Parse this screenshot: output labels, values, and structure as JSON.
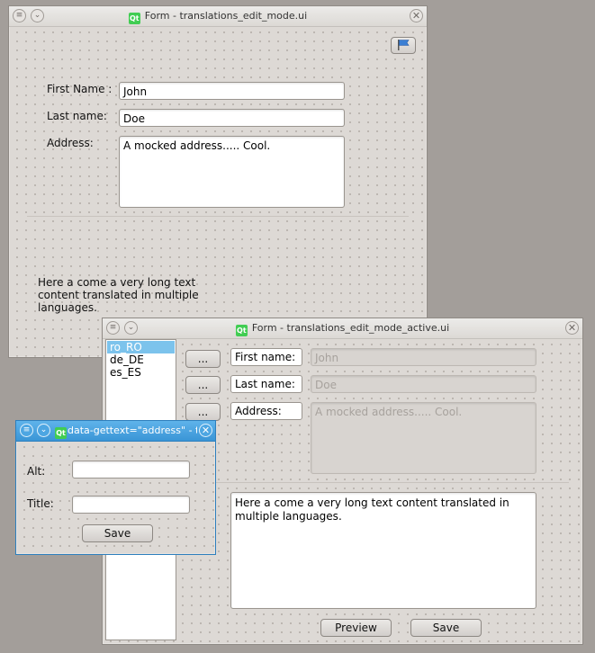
{
  "window1": {
    "title": "Form - translations_edit_mode.ui",
    "labels": {
      "first_name": "First Name :",
      "last_name": "Last name:",
      "address": "Address:"
    },
    "values": {
      "first_name": "John",
      "last_name": "Doe",
      "address": "A mocked address..... Cool."
    },
    "long_text": "Here a come a very long text content translated in multiple languages."
  },
  "window2": {
    "title": "Form - translations_edit_mode_active.ui",
    "locales": [
      "ro_RO",
      "de_DE",
      "es_ES"
    ],
    "selected_locale": "ro_RO",
    "ellipsis_label": "...",
    "labels": {
      "first_name": "First name:",
      "last_name": "Last name:",
      "address": "Address:"
    },
    "values": {
      "first_name": "John",
      "last_name": "Doe",
      "address": "A mocked address..... Cool."
    },
    "long_text": "Here a come a very long text content translated in multiple languages.",
    "preview_label": "Preview",
    "save_label": "Save"
  },
  "dialog": {
    "title": "data-gettext=\"address\" - tr...",
    "alt_label": "Alt:",
    "title_label": "Title:",
    "alt_value": "",
    "title_value": "",
    "save_label": "Save"
  },
  "colors": {
    "qt_green": "#41cd52",
    "active_titlebar": "#3a95d6",
    "selection": "#7cc3ec"
  },
  "icons": [
    "menu-icon",
    "minimize-icon",
    "close-icon",
    "qt-logo-icon",
    "flag-icon"
  ]
}
